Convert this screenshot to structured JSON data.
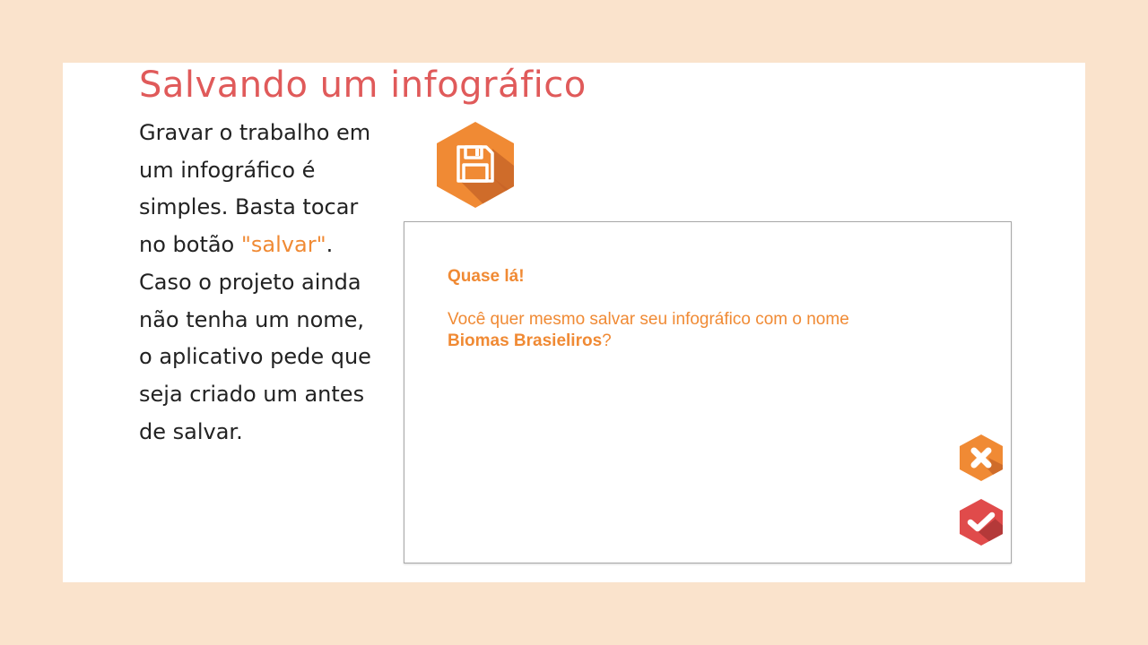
{
  "slide": {
    "title": "Salvando um infográfico",
    "body_part1": "Gravar o trabalho em um infográfico é simples. Basta tocar no botão ",
    "body_accent": "\"salvar\"",
    "body_part2": ". Caso o projeto ainda não tenha um nome, o aplicativo pede que seja criado um antes de salvar."
  },
  "save_icon": {
    "icon": "floppy-disk-icon",
    "color": "#f08a34"
  },
  "dialog": {
    "title": "Quase lá!",
    "message_prefix": "Você quer mesmo salvar seu infográfico com o nome",
    "project_name": "Biomas Brasieliros",
    "message_suffix": "?",
    "cancel_icon": "close-icon",
    "confirm_icon": "check-icon"
  },
  "colors": {
    "background": "#fae3cc",
    "title": "#e05a5a",
    "accent": "#f08a34",
    "confirm": "#e04b4b"
  }
}
